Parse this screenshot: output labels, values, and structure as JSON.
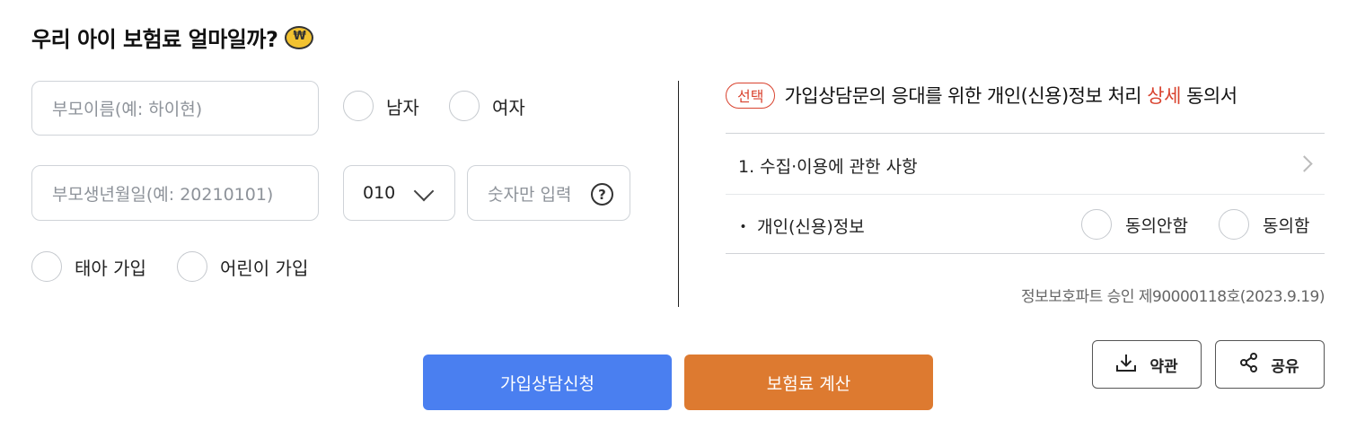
{
  "page": {
    "title": "우리 아이 보험료 얼마일까?",
    "coin_icon": "won-coin-icon"
  },
  "form": {
    "parent_name": {
      "placeholder": "부모이름(예: 하이현)",
      "value": ""
    },
    "gender": [
      {
        "label": "남자",
        "selected": false
      },
      {
        "label": "여자",
        "selected": false
      }
    ],
    "parent_birth": {
      "placeholder": "부모생년월일(예: 20210101)",
      "value": ""
    },
    "phone_prefix": {
      "selected": "010"
    },
    "phone_number": {
      "placeholder": "숫자만 입력",
      "value": ""
    },
    "join_type": [
      {
        "label": "태아 가입",
        "selected": false
      },
      {
        "label": "어린이 가입",
        "selected": false
      }
    ]
  },
  "consent": {
    "badge": "선택",
    "heading_before": "가입상담문의 응대를 위한 개인(신용)정보 처리 ",
    "heading_highlight": "상세",
    "heading_after": " 동의서",
    "item_1": "1. 수집·이용에 관한 사항",
    "item_2": "・ 개인(신용)정보",
    "options": [
      {
        "label": "동의안함",
        "selected": false
      },
      {
        "label": "동의함",
        "selected": false
      }
    ],
    "approval": "정보보호파트 승인 제90000118호(2023.9.19)"
  },
  "actions": {
    "apply_label": "가입상담신청",
    "calc_label": "보험료 계산",
    "terms_label": "약관",
    "share_label": "공유"
  },
  "colors": {
    "accent_red": "#d9432f",
    "button_blue": "#4a7ff0",
    "button_orange": "#dd7a30"
  }
}
